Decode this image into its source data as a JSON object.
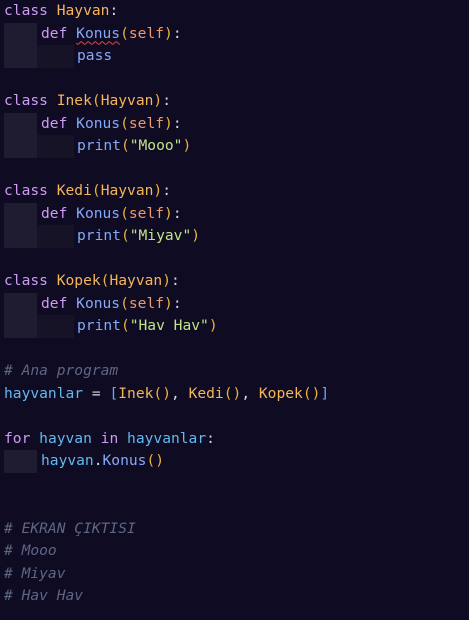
{
  "code": {
    "kw_class": "class",
    "kw_def": "def",
    "kw_pass": "pass",
    "kw_for": "for",
    "kw_in": "in",
    "self": "self",
    "method": "Konus",
    "print": "print",
    "base": "Hayvan",
    "classes": {
      "hayvan": "Hayvan",
      "inek": "Inek",
      "kedi": "Kedi",
      "kopek": "Kopek"
    },
    "strings": {
      "inek": "\"Mooo\"",
      "kedi": "\"Miyav\"",
      "kopek": "\"Hav Hav\""
    },
    "comments": {
      "main": "# Ana program",
      "output_header": "# EKRAN ÇIKTISI",
      "out1": "# Mooo",
      "out2": "# Miyav",
      "out3": "# Hav Hav"
    },
    "vars": {
      "list": "hayvanlar",
      "item": "hayvan"
    }
  }
}
